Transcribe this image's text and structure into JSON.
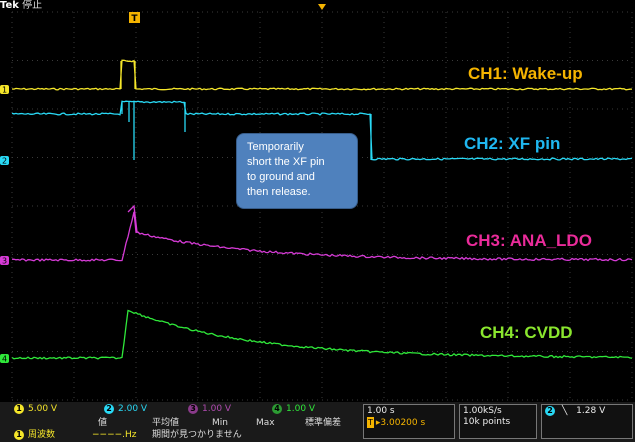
{
  "header": {
    "brand": "Tek",
    "mode": "停止"
  },
  "labels": {
    "ch1": "CH1: Wake-up",
    "ch2": "CH2: XF pin",
    "ch3": "CH3: ANA_LDO",
    "ch4": "CH4: CVDD"
  },
  "channel_markers": [
    "1",
    "2",
    "3",
    "4"
  ],
  "trigger_marker": "T",
  "callout": {
    "lines": [
      "Temporarily",
      "short the XF pin",
      "to ground and",
      "then  release."
    ]
  },
  "status_bar": {
    "channels": [
      {
        "id": "1",
        "scale": "5.00 V",
        "color": "#f5e62a"
      },
      {
        "id": "2",
        "scale": "2.00 V",
        "color": "#29d9f5"
      },
      {
        "id": "3",
        "scale": "1.00 V",
        "color": "#d63bd6"
      },
      {
        "id": "4",
        "scale": "1.00 V",
        "color": "#2fe83a"
      }
    ],
    "measure_headers": [
      "値",
      "平均値",
      "Min",
      "Max",
      "標準偏差"
    ],
    "measure_row": {
      "ch": "1",
      "name": "周波数",
      "value": "−−−−.Hz",
      "status": "期間が見つかりません"
    },
    "timebase": "1.00 s",
    "trigger_pos": "▸3.00200 s",
    "sample_rate": "1.00kS/s",
    "record_length": "10k points",
    "trigger_source": "2",
    "trigger_slope": "╲",
    "trigger_level": "1.28 V"
  },
  "colors": {
    "ch1": "#f5e62a",
    "ch2": "#29d9f5",
    "ch3": "#d63bd6",
    "ch4": "#2fe83a",
    "label_ch1": "#f5b400",
    "label_ch2": "#1fb7f0",
    "label_ch3": "#ea2b9a",
    "label_ch4": "#8ae62e"
  }
}
